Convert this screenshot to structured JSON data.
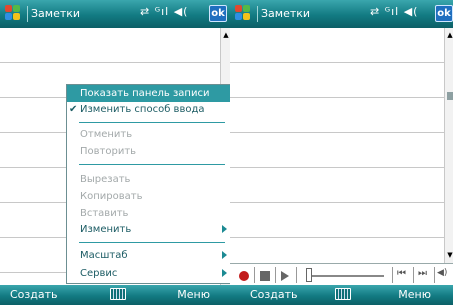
{
  "left": {
    "titlebar": {
      "app_title": "Заметки",
      "status_icons": "⇄ ᴳıl ◀(",
      "ok_label": "ok"
    },
    "menu": {
      "items": [
        {
          "label": "Показать панель записи",
          "state": "highlighted"
        },
        {
          "label": "Изменить способ ввода",
          "state": "checked"
        },
        {
          "label": "Отменить",
          "state": "disabled"
        },
        {
          "label": "Повторить",
          "state": "disabled"
        },
        {
          "label": "Вырезать",
          "state": "disabled"
        },
        {
          "label": "Копировать",
          "state": "disabled"
        },
        {
          "label": "Вставить",
          "state": "disabled"
        },
        {
          "label": "Изменить",
          "state": "submenu"
        },
        {
          "label": "Масштаб",
          "state": "submenu"
        },
        {
          "label": "Сервис",
          "state": "submenu"
        }
      ],
      "check_glyph": "✔"
    },
    "softbar": {
      "left_label": "Создать",
      "right_label": "Меню"
    }
  },
  "right": {
    "titlebar": {
      "app_title": "Заметки",
      "status_icons": "⇄ ᴳıl ◀(",
      "ok_label": "ok"
    },
    "recorder": {
      "rewind_glyph": "⏮",
      "forward_glyph": "⏭",
      "volume_glyph": "◀)"
    },
    "softbar": {
      "left_label": "Создать",
      "right_label": "Меню"
    }
  },
  "colors": {
    "titlebar_accent": "#127a82",
    "menu_highlight": "#2e9aa3",
    "menu_text": "#1c5c64",
    "menu_disabled": "#a3a9aa",
    "record_red": "#c21a1a"
  }
}
